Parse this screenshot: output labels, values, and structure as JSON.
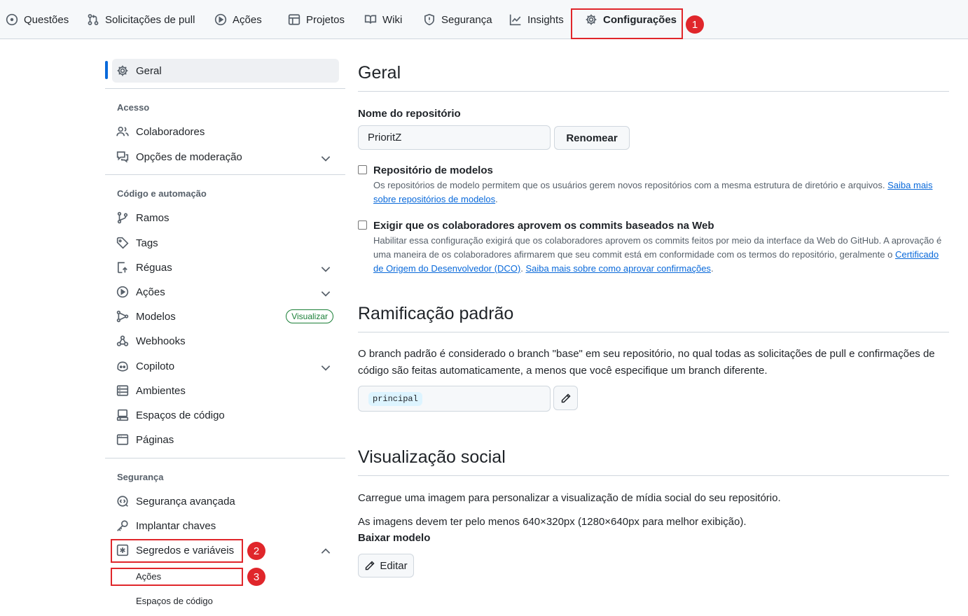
{
  "tabs": [
    {
      "label": "Questões",
      "icon": "issue-icon"
    },
    {
      "label": "Solicitações de pull",
      "icon": "pull-request-icon"
    },
    {
      "label": "Ações",
      "icon": "play-icon"
    },
    {
      "label": "Projetos",
      "icon": "table-icon"
    },
    {
      "label": "Wiki",
      "icon": "book-icon"
    },
    {
      "label": "Segurança",
      "icon": "shield-icon"
    },
    {
      "label": "Insights",
      "icon": "graph-icon"
    },
    {
      "label": "Configurações",
      "icon": "gear-icon",
      "active": true
    }
  ],
  "annotations": [
    "1",
    "2",
    "3"
  ],
  "sidebar": {
    "general": "Geral",
    "access_heading": "Acesso",
    "access_items": [
      {
        "label": "Colaboradores",
        "icon": "people-icon"
      },
      {
        "label": "Opções de moderação",
        "icon": "comment-discussion-icon",
        "expandable": true
      }
    ],
    "code_heading": "Código e automação",
    "code_items": [
      {
        "label": "Ramos",
        "icon": "git-branch-icon"
      },
      {
        "label": "Tags",
        "icon": "tag-icon"
      },
      {
        "label": "Réguas",
        "icon": "rules-icon",
        "expandable": true
      },
      {
        "label": "Ações",
        "icon": "play-icon",
        "expandable": true
      },
      {
        "label": "Modelos",
        "icon": "models-icon",
        "pill": "Visualizar"
      },
      {
        "label": "Webhooks",
        "icon": "webhook-icon"
      },
      {
        "label": "Copiloto",
        "icon": "copilot-icon",
        "expandable": true
      },
      {
        "label": "Ambientes",
        "icon": "server-icon"
      },
      {
        "label": "Espaços de código",
        "icon": "codespaces-icon"
      },
      {
        "label": "Páginas",
        "icon": "browser-icon"
      }
    ],
    "security_heading": "Segurança",
    "security_items": [
      {
        "label": "Segurança avançada",
        "icon": "codescan-icon"
      },
      {
        "label": "Implantar chaves",
        "icon": "key-icon"
      },
      {
        "label": "Segredos e variáveis",
        "icon": "asterisk-icon",
        "expanded": true
      }
    ],
    "secrets_sub": [
      "Ações",
      "Espaços de código"
    ]
  },
  "main": {
    "general_title": "Geral",
    "repo_name_label": "Nome do repositório",
    "repo_name_value": "PrioritZ",
    "rename_button": "Renomear",
    "template": {
      "label": "Repositório de modelos",
      "desc": "Os repositórios de modelo permitem que os usuários gerem novos repositórios com a mesma estrutura de diretório e arquivos.",
      "link_a": "Saiba mais",
      "link_b": "sobre repositórios de modelos"
    },
    "signoff": {
      "label": "Exigir que os colaboradores aprovem os commits baseados na Web",
      "desc_line1": "Habilitar essa configuração exigirá que os colaboradores aprovem os commits feitos por meio da interface da Web do GitHub. A aprovação é",
      "desc_line2": "uma maneira de os colaboradores afirmarem que seu commit está em conformidade com os termos do repositório, geralmente o",
      "link_cert_a": "Certificado",
      "link_cert_b": "de Origem do Desenvolvedor (DCO)",
      "link_learn": "Saiba mais sobre como aprovar confirmações"
    },
    "default_branch_title": "Ramificação padrão",
    "default_branch_desc": "O branch padrão é considerado o branch \"base\" em seu repositório, no qual todas as solicitações de pull e confirmações de código são feitas automaticamente, a menos que você especifique um branch diferente.",
    "default_branch_value": "principal",
    "social_title": "Visualização social",
    "social_desc": "Carregue uma imagem para personalizar a visualização de mídia social do seu repositório.",
    "social_size": "As imagens devem ter pelo menos 640×320px (1280×640px para melhor exibição).",
    "download_template": "Baixar modelo",
    "edit_button": "Editar"
  }
}
